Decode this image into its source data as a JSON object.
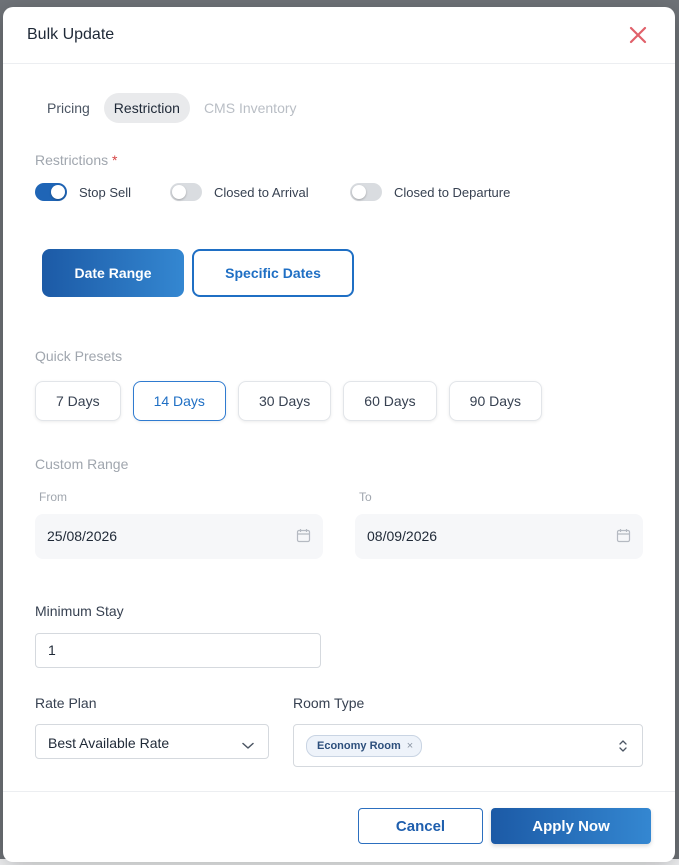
{
  "modal": {
    "title": "Bulk Update",
    "close_icon": "close-icon"
  },
  "tabs": [
    {
      "label": "Pricing",
      "state": "default"
    },
    {
      "label": "Restriction",
      "state": "active"
    },
    {
      "label": "CMS Inventory",
      "state": "disabled"
    }
  ],
  "restrictions": {
    "label": "Restrictions",
    "required_mark": "*",
    "toggles": [
      {
        "label": "Stop Sell",
        "on": true
      },
      {
        "label": "Closed to Arrival",
        "on": false
      },
      {
        "label": "Closed to Departure",
        "on": false
      }
    ]
  },
  "date_mode": {
    "date_range": "Date Range",
    "specific_dates": "Specific Dates",
    "selected": "date_range"
  },
  "quick_presets": {
    "label": "Quick Presets",
    "options": [
      "7 Days",
      "14 Days",
      "30 Days",
      "60 Days",
      "90 Days"
    ],
    "selected": "14 Days"
  },
  "custom_range": {
    "label": "Custom Range",
    "from_label": "From",
    "from_value": "25/08/2026",
    "to_label": "To",
    "to_value": "08/09/2026"
  },
  "minimum_stay": {
    "label": "Minimum Stay",
    "value": "1"
  },
  "rate_plan": {
    "label": "Rate Plan",
    "value": "Best Available Rate"
  },
  "room_type": {
    "label": "Room Type",
    "chips": [
      "Economy Room"
    ],
    "chip_remove": "×"
  },
  "footer": {
    "cancel": "Cancel",
    "apply": "Apply Now"
  },
  "colors": {
    "primary": "#1f65b6",
    "close": "#e0606a",
    "muted_label": "#a0a6ae"
  }
}
